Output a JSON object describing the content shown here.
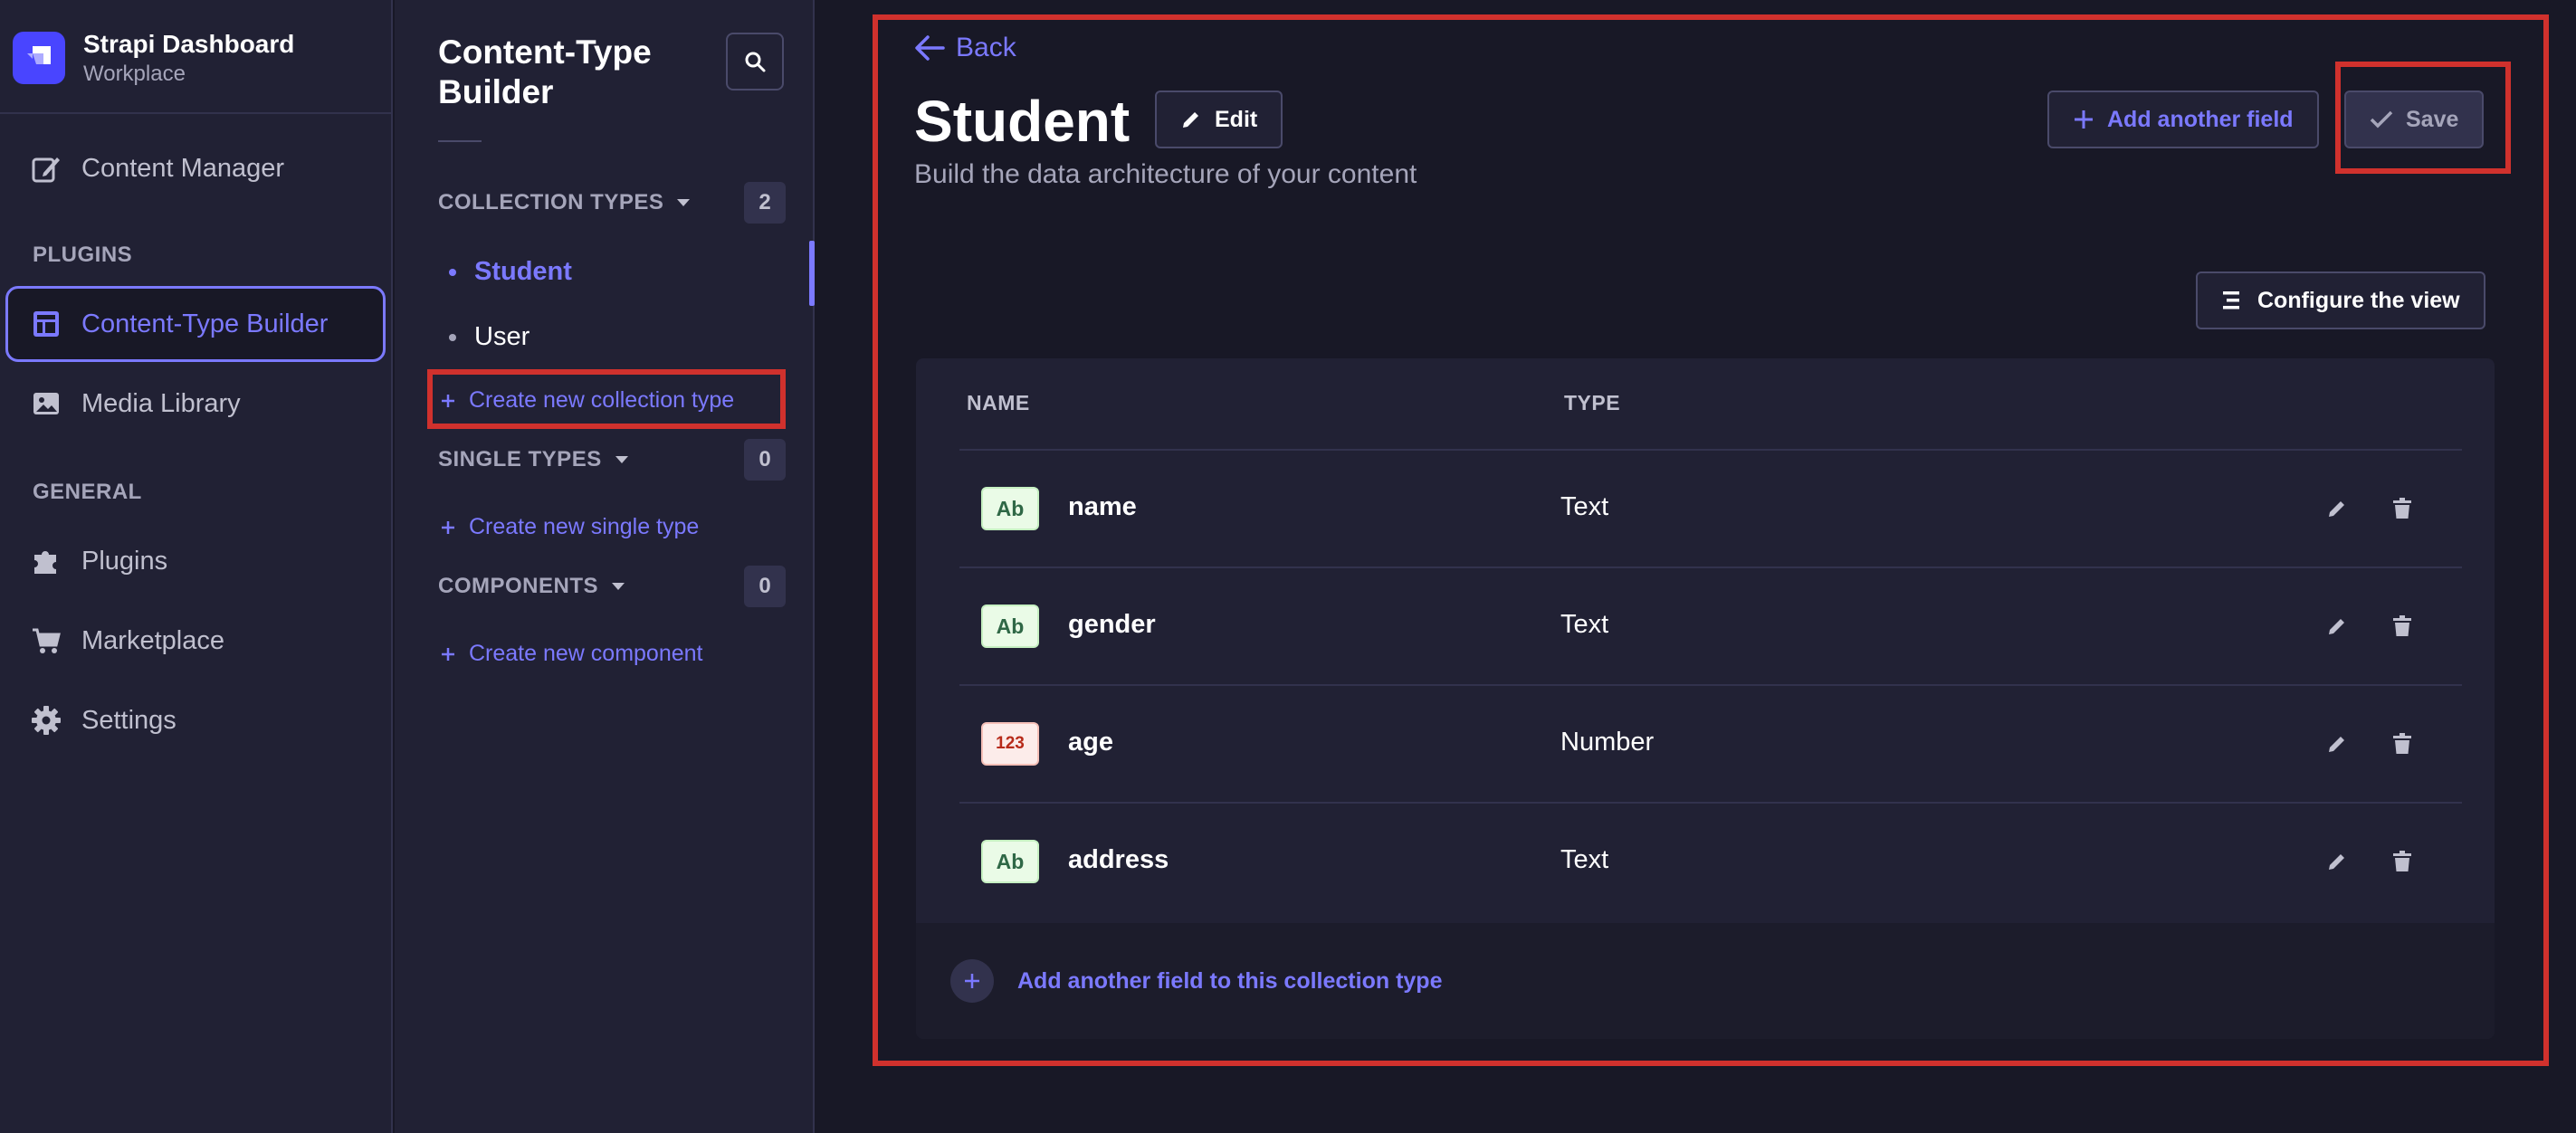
{
  "brand": {
    "title": "Strapi Dashboard",
    "subtitle": "Workplace",
    "logo_color": "#4945ff"
  },
  "main_nav": {
    "items": [
      {
        "label": "Content Manager",
        "icon": "feather-pen-icon",
        "active": false
      },
      {
        "label": "Content-Type Builder",
        "icon": "layout-icon",
        "active": true
      },
      {
        "label": "Media Library",
        "icon": "picture-icon",
        "active": false
      },
      {
        "label": "Plugins",
        "icon": "puzzle-icon",
        "active": false
      },
      {
        "label": "Marketplace",
        "icon": "cart-icon",
        "active": false
      },
      {
        "label": "Settings",
        "icon": "gear-icon",
        "active": false
      }
    ],
    "sections": [
      "PLUGINS",
      "GENERAL"
    ]
  },
  "sub_nav": {
    "title": "Content-Type Builder",
    "collection_types": {
      "label": "COLLECTION TYPES",
      "count": "2",
      "items": [
        {
          "label": "Student",
          "active": true
        },
        {
          "label": "User",
          "active": false
        }
      ],
      "create_label": "Create new collection type"
    },
    "single_types": {
      "label": "SINGLE TYPES",
      "count": "0",
      "create_label": "Create new single type"
    },
    "components": {
      "label": "COMPONENTS",
      "count": "0",
      "create_label": "Create new component"
    }
  },
  "header": {
    "back_label": "Back",
    "title": "Student",
    "edit_label": "Edit",
    "subtitle": "Build the data architecture of your content",
    "add_field_label": "Add another field",
    "save_label": "Save",
    "configure_label": "Configure the view"
  },
  "table": {
    "columns": [
      "NAME",
      "TYPE"
    ],
    "rows": [
      {
        "badge": "Ab",
        "kind": "text",
        "name": "name",
        "type": "Text"
      },
      {
        "badge": "Ab",
        "kind": "text",
        "name": "gender",
        "type": "Text"
      },
      {
        "badge": "123",
        "kind": "number",
        "name": "age",
        "type": "Number"
      },
      {
        "badge": "Ab",
        "kind": "text",
        "name": "address",
        "type": "Text"
      }
    ],
    "footer_label": "Add another field to this collection type"
  },
  "colors": {
    "accent": "#7b79ff",
    "background": "#181826",
    "panel": "#212134",
    "highlight_box": "#d0312d"
  }
}
